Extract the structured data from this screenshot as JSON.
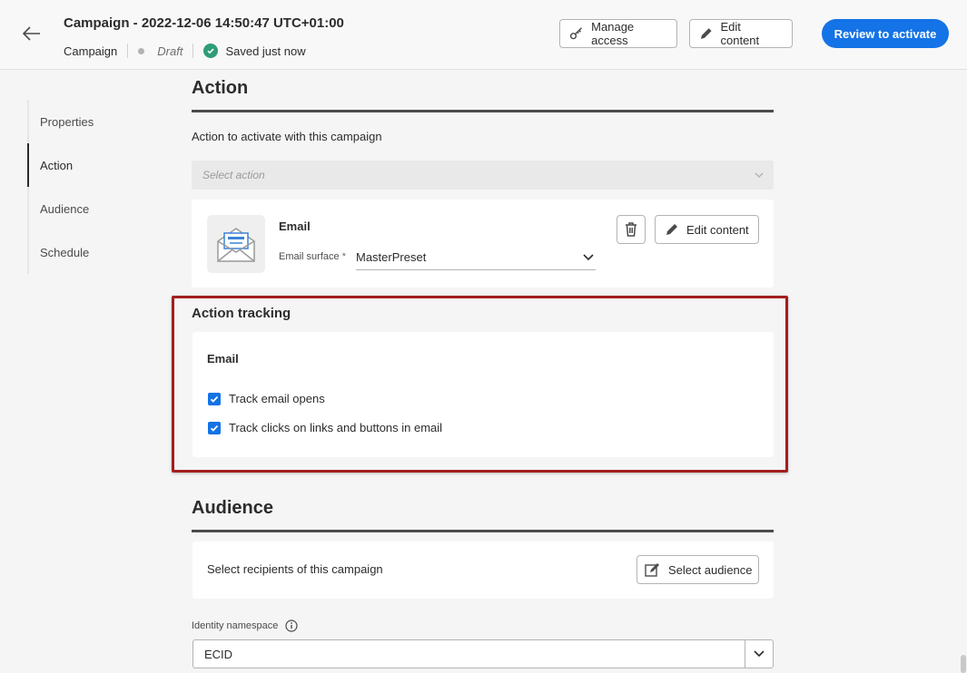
{
  "header": {
    "title": "Campaign - 2022-12-06 14:50:47 UTC+01:00",
    "type": "Campaign",
    "status": "Draft",
    "saved": "Saved just now",
    "manage_access": "Manage access",
    "edit_content": "Edit content",
    "review": "Review to activate"
  },
  "nav": {
    "items": [
      {
        "label": "Properties"
      },
      {
        "label": "Action"
      },
      {
        "label": "Audience"
      },
      {
        "label": "Schedule"
      }
    ],
    "active": "Action"
  },
  "action": {
    "title": "Action",
    "subtitle": "Action to activate with this campaign",
    "select_placeholder": "Select action",
    "email": {
      "name": "Email",
      "surface_label": "Email surface",
      "required_mark": "*",
      "surface_value": "MasterPreset",
      "edit_content": "Edit content"
    }
  },
  "tracking": {
    "title": "Action tracking",
    "channel": "Email",
    "options": [
      {
        "label": "Track email opens",
        "checked": true
      },
      {
        "label": "Track clicks on links and buttons in email",
        "checked": true
      }
    ]
  },
  "audience": {
    "title": "Audience",
    "prompt": "Select recipients of this campaign",
    "select_button": "Select audience",
    "identity_label": "Identity namespace",
    "identity_value": "ECID"
  },
  "colors": {
    "accent": "#1473e6",
    "success": "#2d9d78",
    "highlight_border": "#a31e1e"
  }
}
